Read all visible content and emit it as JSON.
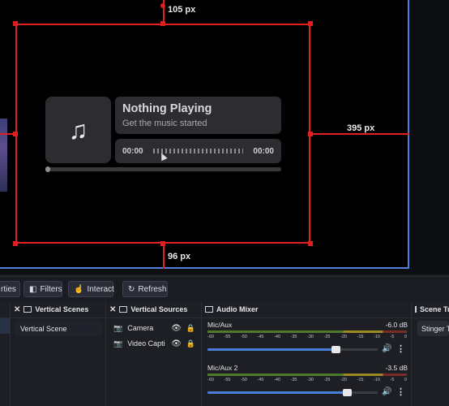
{
  "preview": {
    "dim_top": "105 px",
    "dim_right": "395 px",
    "dim_bottom": "96 px"
  },
  "widget": {
    "title": "Nothing Playing",
    "subtitle": "Get the music started",
    "time_start": "00:00",
    "time_end": "00:00",
    "icon": "music-note-icon",
    "progress": 0.0
  },
  "toolbar": {
    "properties_label": "rties",
    "filters_label": "Filters",
    "interact_label": "Interact",
    "refresh_label": "Refresh"
  },
  "docks": {
    "scenes": {
      "title": "Vertical Scenes",
      "items": [
        "Vertical Scene"
      ]
    },
    "sources": {
      "title": "Vertical Sources",
      "items": [
        {
          "label": "Camera",
          "icon": "camera-icon"
        },
        {
          "label": "Video Capti",
          "icon": "camera-icon"
        }
      ]
    },
    "mixer": {
      "title": "Audio Mixer",
      "ticks": [
        "-60",
        "-55",
        "-50",
        "-45",
        "-40",
        "-35",
        "-30",
        "-25",
        "-20",
        "-15",
        "-10",
        "-5",
        "0"
      ],
      "channels": [
        {
          "name": "Mic/Aux",
          "db": "-6.0 dB",
          "volume": 0.75
        },
        {
          "name": "Mic/Aux 2",
          "db": "-3.5 dB",
          "volume": 0.82
        }
      ]
    },
    "transitions": {
      "title": "Scene Tr",
      "item": "Stinger Tr"
    }
  },
  "colors": {
    "accent": "#4f7fd8",
    "guide": "#e02020",
    "panel": "#1e1f24"
  }
}
